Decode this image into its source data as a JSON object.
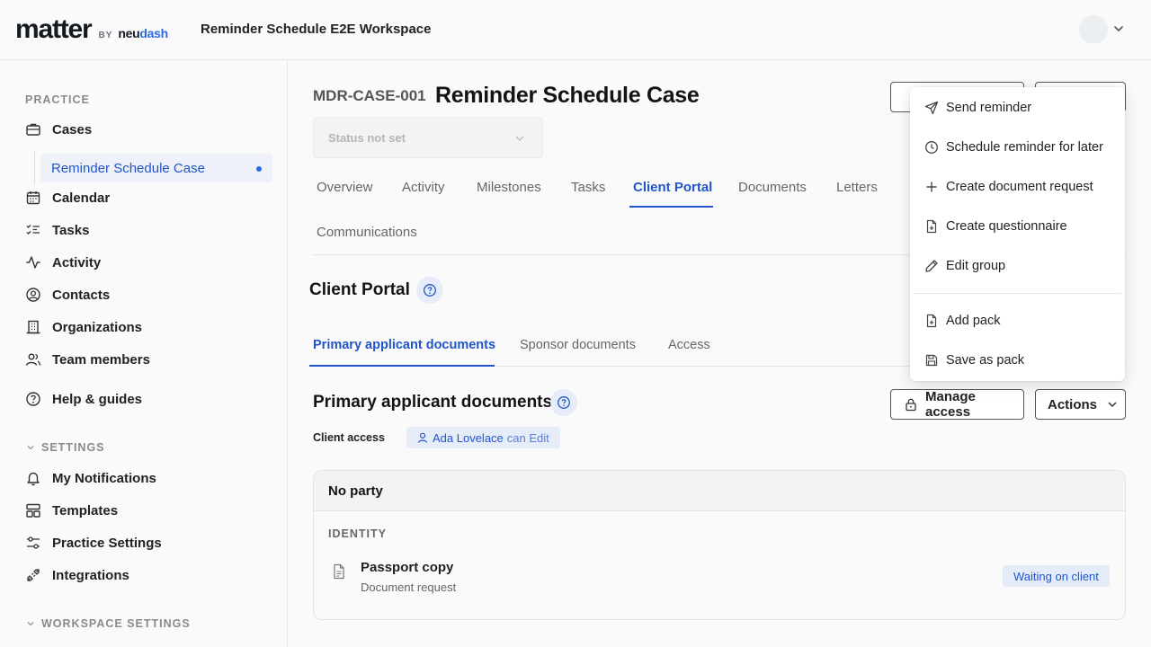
{
  "header": {
    "logo_main": "matter",
    "logo_by": "BY",
    "logo_neu": "neu",
    "logo_dash": "dash",
    "workspace": "Reminder Schedule E2E Workspace"
  },
  "sidebar": {
    "practice_label": "PRACTICE",
    "items": [
      {
        "label": "Cases",
        "icon": "briefcase-icon"
      },
      {
        "label": "Calendar",
        "icon": "calendar-icon"
      },
      {
        "label": "Tasks",
        "icon": "tasks-icon"
      },
      {
        "label": "Activity",
        "icon": "activity-icon"
      },
      {
        "label": "Contacts",
        "icon": "contacts-icon"
      },
      {
        "label": "Organizations",
        "icon": "organizations-icon"
      },
      {
        "label": "Team members",
        "icon": "team-icon"
      },
      {
        "label": "Help & guides",
        "icon": "help-icon"
      }
    ],
    "active_case": "Reminder Schedule Case",
    "settings_label": "SETTINGS",
    "settings_items": [
      {
        "label": "My Notifications",
        "icon": "bell-icon"
      },
      {
        "label": "Templates",
        "icon": "templates-icon"
      },
      {
        "label": "Practice Settings",
        "icon": "sliders-icon"
      },
      {
        "label": "Integrations",
        "icon": "integrations-icon"
      }
    ],
    "workspace_settings_label": "WORKSPACE SETTINGS"
  },
  "case": {
    "id": "MDR-CASE-001",
    "title": "Reminder Schedule Case",
    "status_placeholder": "Status not set"
  },
  "tabs": [
    {
      "label": "Overview"
    },
    {
      "label": "Activity"
    },
    {
      "label": "Milestones"
    },
    {
      "label": "Tasks"
    },
    {
      "label": "Client Portal"
    },
    {
      "label": "Documents"
    },
    {
      "label": "Letters"
    },
    {
      "label": "Communications"
    }
  ],
  "client_portal": {
    "title": "Client Portal",
    "subtabs": [
      {
        "label": "Primary applicant documents"
      },
      {
        "label": "Sponsor documents"
      },
      {
        "label": "Access"
      }
    ],
    "section_title": "Primary applicant documents",
    "manage_access_label": "Manage access",
    "actions_label": "Actions",
    "client_access_label": "Client access",
    "access_user": "Ada Lovelace",
    "access_perm": "can Edit",
    "card": {
      "party": "No party",
      "group": "IDENTITY",
      "doc_name": "Passport copy",
      "doc_type": "Document request",
      "doc_status": "Waiting on client"
    }
  },
  "menu": {
    "items": [
      {
        "label": "Send reminder",
        "icon": "send-icon"
      },
      {
        "label": "Schedule reminder for later",
        "icon": "clock-icon"
      },
      {
        "label": "Create document request",
        "icon": "plus-icon"
      },
      {
        "label": "Create questionnaire",
        "icon": "file-plus-icon"
      },
      {
        "label": "Edit group",
        "icon": "pencil-icon"
      },
      {
        "label": "Add pack",
        "icon": "file-plus-icon"
      },
      {
        "label": "Save as pack",
        "icon": "save-icon"
      }
    ]
  },
  "colors": {
    "accent": "#2155c9",
    "accent_bg": "#e6ecf8"
  }
}
